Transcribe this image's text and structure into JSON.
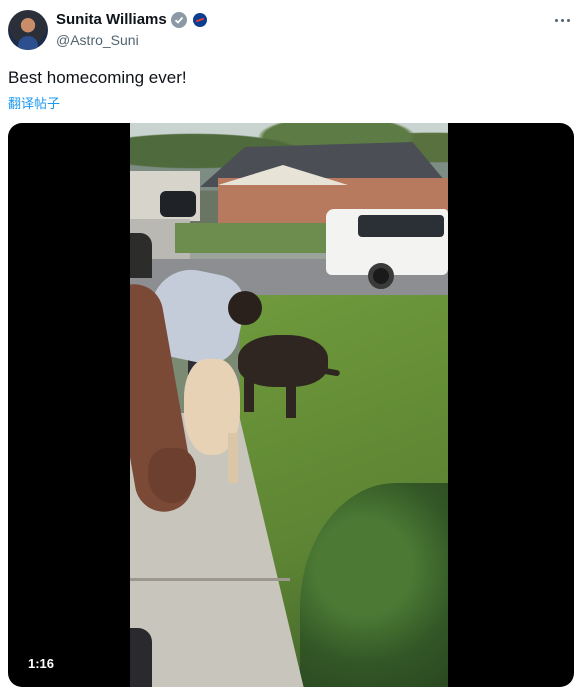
{
  "author": {
    "name": "Sunita Williams",
    "handle": "@Astro_Suni",
    "verified_icon": "verified-badge-icon",
    "affiliate_icon": "nasa-logo-icon"
  },
  "tweet": {
    "text": "Best homecoming ever!",
    "translate_label": "翻译帖子"
  },
  "media": {
    "type": "video",
    "duration": "1:16"
  },
  "colors": {
    "link": "#1d9bf0",
    "secondary_text": "#536471",
    "verified_badge": "#8b98a5"
  }
}
